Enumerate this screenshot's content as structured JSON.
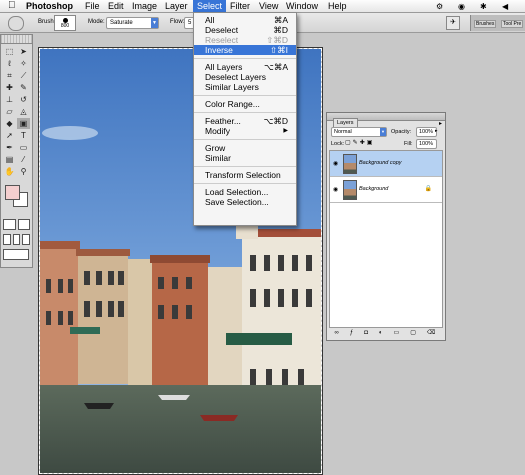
{
  "menubar": {
    "apple_icon": "apple-icon",
    "app_name": "Photoshop",
    "items": [
      "File",
      "Edit",
      "Image",
      "Layer",
      "Select",
      "Filter",
      "View",
      "Window",
      "Help"
    ],
    "active": "Select"
  },
  "options_bar": {
    "brush_label": "Brush:",
    "brush_size": "800",
    "mode_label": "Mode:",
    "mode_value": "Saturate",
    "flow_label": "Flow:",
    "flow_value": "5",
    "well_tabs": [
      "Brushes",
      "Tool Pre"
    ]
  },
  "select_menu": {
    "items": [
      {
        "label": "All",
        "shortcut": "⌘A",
        "state": "normal"
      },
      {
        "label": "Deselect",
        "shortcut": "⌘D",
        "state": "normal"
      },
      {
        "label": "Reselect",
        "shortcut": "⇧⌘D",
        "state": "disabled"
      },
      {
        "label": "Inverse",
        "shortcut": "⇧⌘I",
        "state": "highlighted"
      },
      {
        "label": "All Layers",
        "shortcut": "⌥⌘A",
        "state": "normal",
        "sep_before": true
      },
      {
        "label": "Deselect Layers",
        "shortcut": "",
        "state": "normal"
      },
      {
        "label": "Similar Layers",
        "shortcut": "",
        "state": "normal"
      },
      {
        "label": "Color Range...",
        "shortcut": "",
        "state": "normal",
        "sep_before": true
      },
      {
        "label": "Feather...",
        "shortcut": "⌥⌘D",
        "state": "normal",
        "sep_before": true
      },
      {
        "label": "Modify",
        "shortcut": "▶",
        "state": "normal"
      },
      {
        "label": "Grow",
        "shortcut": "",
        "state": "normal",
        "sep_before": true
      },
      {
        "label": "Similar",
        "shortcut": "",
        "state": "normal"
      },
      {
        "label": "Transform Selection",
        "shortcut": "",
        "state": "normal",
        "sep_before": true
      },
      {
        "label": "Load Selection...",
        "shortcut": "",
        "state": "normal",
        "sep_before": true
      },
      {
        "label": "Save Selection...",
        "shortcut": "",
        "state": "normal"
      }
    ]
  },
  "layers_panel": {
    "tab": "Layers",
    "blend_mode": "Normal",
    "opacity_label": "Opacity:",
    "opacity_value": "100%",
    "lock_label": "Lock:",
    "fill_label": "Fill:",
    "fill_value": "100%",
    "layers": [
      {
        "name": "Background copy",
        "selected": true,
        "locked": false
      },
      {
        "name": "Background",
        "selected": false,
        "locked": true
      }
    ]
  },
  "colors": {
    "accent": "#3875d7",
    "foreground_swatch": "#f4cfcf",
    "background_swatch": "#ffffff",
    "layer_selected": "#b5d1f2"
  }
}
